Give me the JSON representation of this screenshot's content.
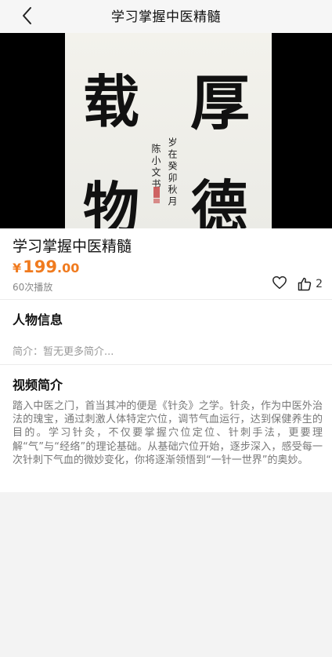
{
  "header": {
    "title": "学习掌握中医精髓",
    "back_icon": "chevron-left-icon"
  },
  "hero": {
    "calligraphy": [
      "厚",
      "德",
      "载",
      "物"
    ],
    "inscription_right": "岁在癸卯秋月",
    "inscription_left": "陈小文书"
  },
  "course": {
    "name": "学习掌握中医精髓",
    "price_symbol": "¥",
    "price_int": "199",
    "price_dec": ".00",
    "plays": "60次播放",
    "likes": "2",
    "accent_color": "#f07b1f"
  },
  "person": {
    "heading": "人物信息",
    "intro": "简介：暂无更多简介..."
  },
  "video_intro": {
    "heading": "视频简介",
    "text": "踏入中医之门，首当其冲的便是《针灸》之学。针灸，作为中医外治法的瑰宝，通过刺激人体特定穴位，调节气血运行，达到保健养生的目的。学习针灸，不仅要掌握穴位定位、针刺手法，更要理解“气”与“经络”的理论基础。从基础穴位开始，逐步深入，感受每一次针刺下气血的微妙变化，你将逐渐领悟到“一针一世界”的奥妙。"
  }
}
